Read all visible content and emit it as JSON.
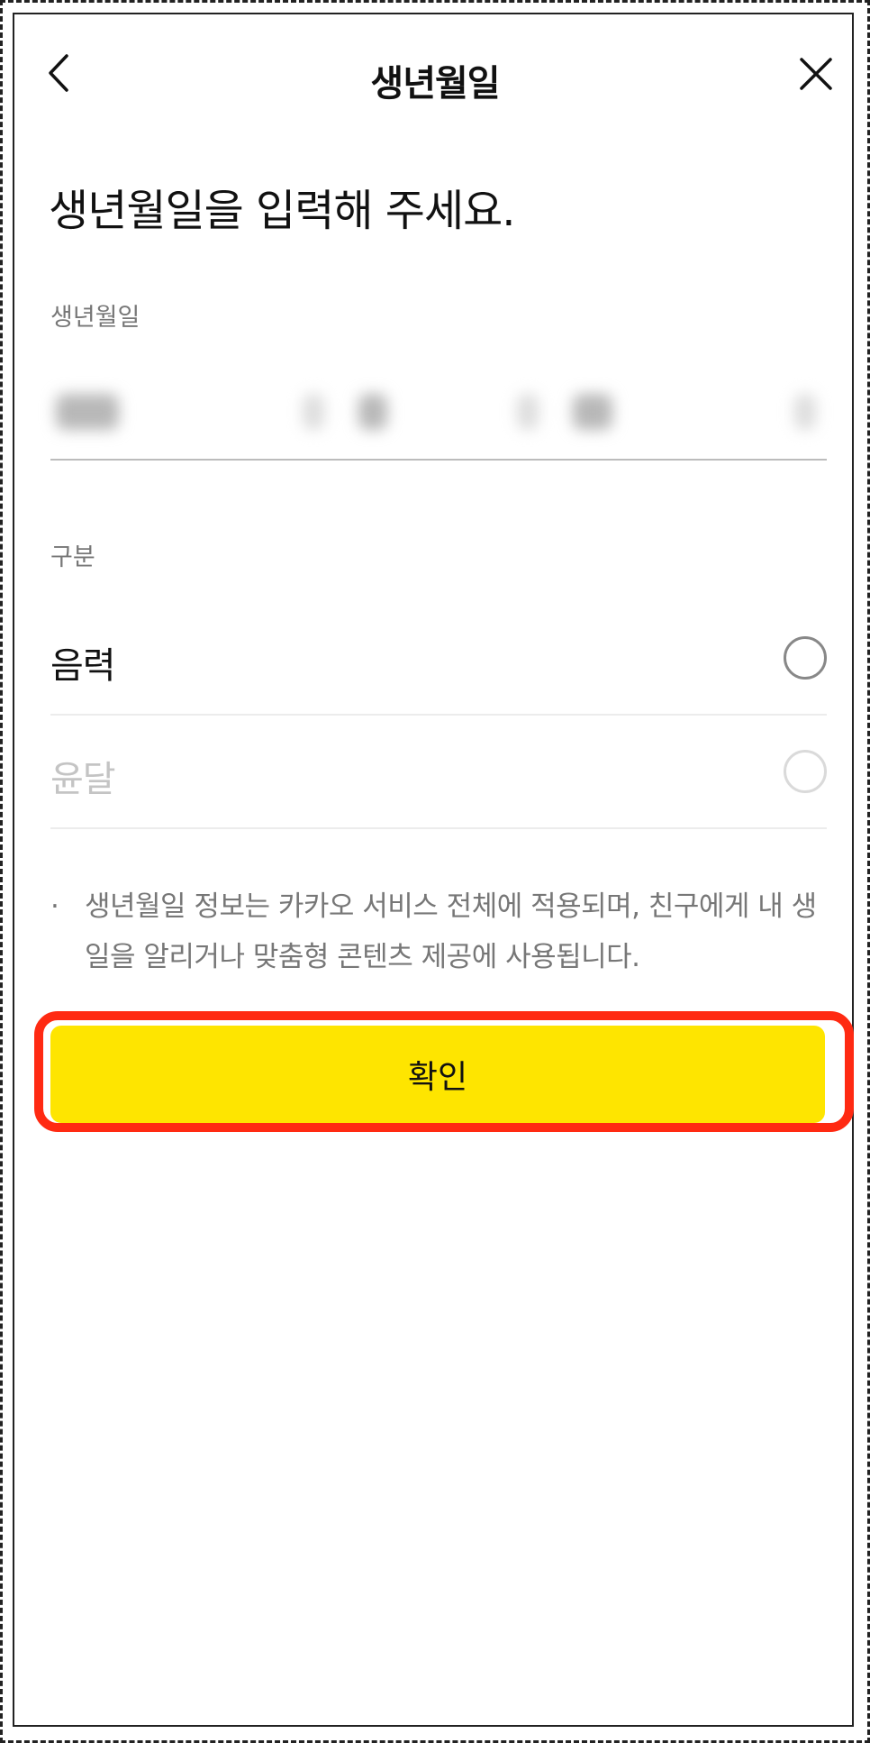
{
  "header": {
    "title": "생년월일",
    "back_icon": "chevron-left-icon",
    "close_icon": "close-icon"
  },
  "heading": "생년월일을 입력해 주세요.",
  "birthdate": {
    "label": "생년월일"
  },
  "calendar_type": {
    "label": "구분",
    "options": [
      {
        "label": "음력",
        "selected": false,
        "enabled": true
      },
      {
        "label": "윤달",
        "selected": false,
        "enabled": false
      }
    ]
  },
  "note": {
    "bullet": "·",
    "text": "생년월일 정보는 카카오 서비스 전체에 적용되며, 친구에게 내 생일을 알리거나 맞춤형 콘텐츠 제공에 사용됩니다."
  },
  "confirm": {
    "label": "확인"
  },
  "colors": {
    "accent_yellow": "#fee500",
    "highlight_red": "#ff2a12",
    "text_primary": "#111111",
    "text_secondary": "#777777",
    "text_disabled": "#c4c4c4"
  }
}
